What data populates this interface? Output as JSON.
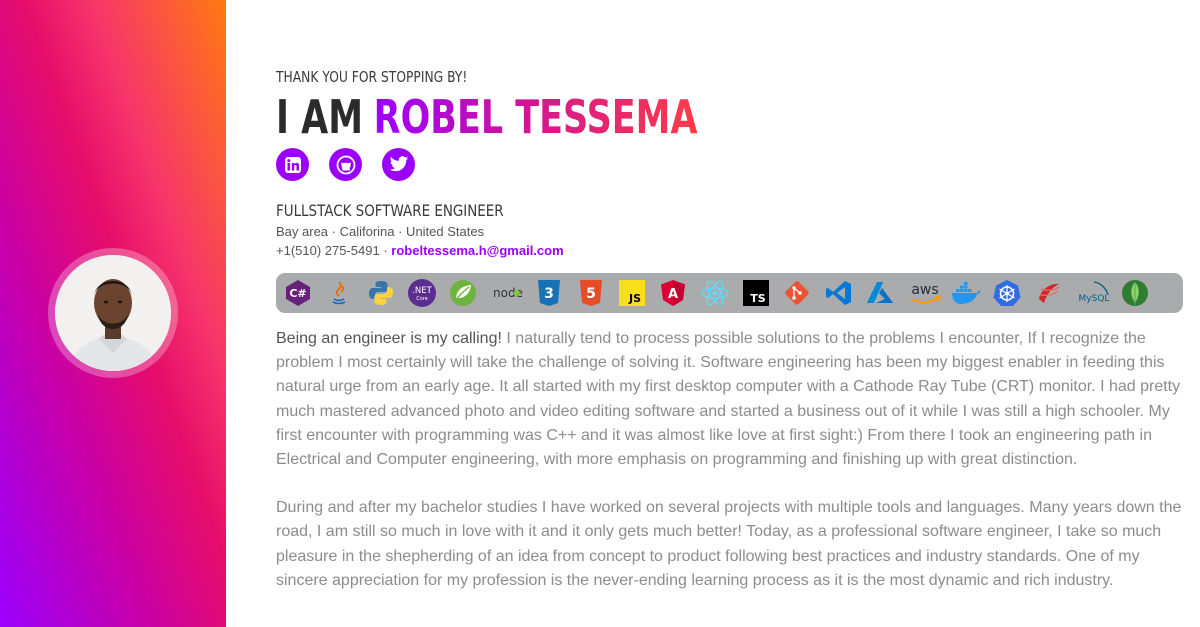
{
  "header": {
    "kicker": "THANK YOU FOR STOPPING BY!",
    "iam": "I AM",
    "name": "ROBEL TESSEMA"
  },
  "socials": [
    {
      "icon": "linkedin-icon",
      "label": "in"
    },
    {
      "icon": "github-icon"
    },
    {
      "icon": "twitter-icon"
    }
  ],
  "profile": {
    "role": "FULLSTACK SOFTWARE ENGINEER",
    "location": "Bay area · Califorina · United States",
    "phone": "+1(510) 275-5491",
    "separator": " · ",
    "email": "robeltessema.h@gmail.com"
  },
  "tech": [
    {
      "name": "csharp-icon",
      "text": "C#"
    },
    {
      "name": "java-icon",
      "text": "java"
    },
    {
      "name": "python-icon",
      "text": "py"
    },
    {
      "name": "dotnet-icon",
      "text": ".NET",
      "sub": "Core"
    },
    {
      "name": "spring-icon",
      "text": "spring"
    },
    {
      "name": "nodejs-icon",
      "text": "node"
    },
    {
      "name": "css3-icon",
      "text": "3"
    },
    {
      "name": "html5-icon",
      "text": "5"
    },
    {
      "name": "javascript-icon",
      "text": "JS"
    },
    {
      "name": "angular-icon",
      "text": "A"
    },
    {
      "name": "react-icon",
      "text": "react"
    },
    {
      "name": "typescript-icon",
      "text": "TS"
    },
    {
      "name": "git-icon",
      "text": "git"
    },
    {
      "name": "vscode-icon",
      "text": "vscode"
    },
    {
      "name": "azure-icon",
      "text": "azure"
    },
    {
      "name": "aws-icon",
      "text": "aws"
    },
    {
      "name": "docker-icon",
      "text": "docker"
    },
    {
      "name": "kubernetes-icon",
      "text": "k8s"
    },
    {
      "name": "sqlserver-icon",
      "text": "sql"
    },
    {
      "name": "mysql-icon",
      "text": "MySQL"
    },
    {
      "name": "mongodb-icon",
      "text": "mongo"
    }
  ],
  "bio": {
    "lead": "Being an engineer is my calling!",
    "p1": " I naturally tend to process possible solutions to the problems I encounter, If I recognize the problem I most certainly will take the challenge of solving it. Software engineering has been my biggest enabler in feeding this natural urge from an early age. It all started with my first desktop computer with a Cathode Ray Tube (CRT) monitor. I had pretty much mastered advanced photo and video editing software and started a business out of it while I was still a high schooler. My first encounter with programming was C++ and it was almost like love at first sight:) From there I took an engineering path in Electrical and Computer engineering, with more emphasis on programming and finishing up with great distinction.",
    "p2": "During and after my bachelor studies I have worked on several projects with multiple tools and languages. Many years down the road, I am still so much in love with it and it only gets much better! Today, as a professional software engineer, I take so much pleasure in the shepherding of an idea from concept to product following best practices and industry standards. One of my sincere appreciation for my profession is the never-ending learning process as it is the most dynamic and rich industry."
  },
  "colors": {
    "accent": "#9b00ff",
    "gradient_start": "#9b00ff",
    "gradient_mid": "#e60d6a",
    "gradient_end": "#ff7a10"
  }
}
